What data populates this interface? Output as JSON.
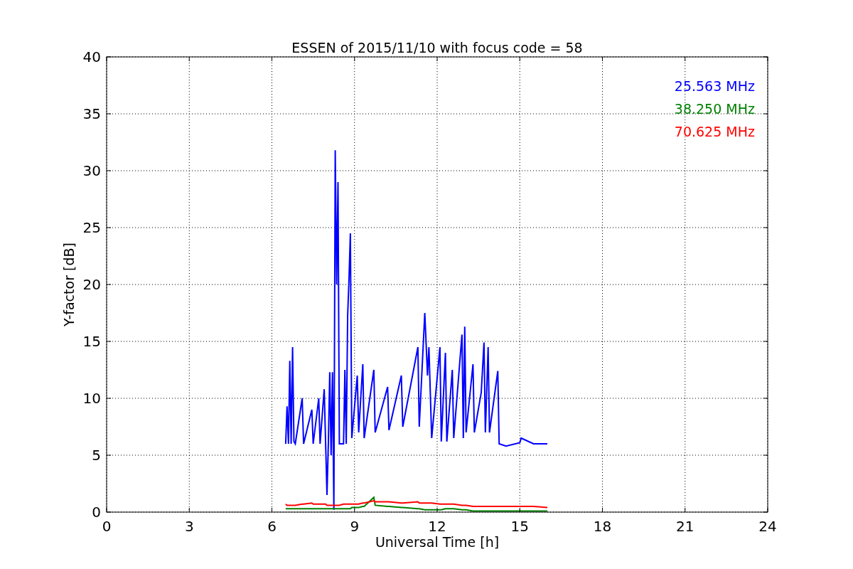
{
  "figure": {
    "chart_data": {
      "type": "line",
      "title": "ESSEN of 2015/11/10 with focus code = 58",
      "xlabel": "Universal Time [h]",
      "ylabel": "Y-factor [dB]",
      "xlim": [
        0,
        24
      ],
      "ylim": [
        0,
        40
      ],
      "xticks": [
        0,
        3,
        6,
        9,
        12,
        15,
        18,
        21,
        24
      ],
      "yticks": [
        0,
        5,
        10,
        15,
        20,
        25,
        30,
        35,
        40
      ],
      "grid": true,
      "x": [
        6.5,
        6.55,
        6.6,
        6.65,
        6.7,
        6.75,
        6.8,
        6.85,
        7.1,
        7.15,
        7.45,
        7.5,
        7.7,
        7.75,
        7.9,
        7.95,
        8.0,
        8.05,
        8.1,
        8.15,
        8.2,
        8.25,
        8.3,
        8.35,
        8.4,
        8.45,
        8.6,
        8.65,
        8.7,
        8.75,
        8.8,
        8.85,
        8.9,
        9.1,
        9.15,
        9.3,
        9.35,
        9.7,
        9.75,
        10.2,
        10.25,
        10.7,
        10.75,
        11.3,
        11.35,
        11.55,
        11.65,
        11.7,
        11.8,
        12.1,
        12.15,
        12.3,
        12.35,
        12.55,
        12.6,
        12.9,
        12.95,
        13.0,
        13.05,
        13.3,
        13.35,
        13.6,
        13.7,
        13.75,
        13.85,
        13.9,
        14.2,
        14.25,
        14.5,
        15.0,
        15.05,
        15.5,
        16.0
      ],
      "series": [
        {
          "name": "25.563 MHz",
          "color": "#0000ff",
          "values": [
            6,
            9.3,
            6,
            13.3,
            6,
            14.5,
            6.2,
            6,
            10,
            6,
            9,
            6,
            10,
            6,
            10.8,
            6,
            1.5,
            6,
            12.3,
            5,
            12.3,
            0.2,
            31.8,
            20,
            29,
            6,
            6,
            12.5,
            6,
            17.3,
            20.5,
            24.5,
            6.5,
            12,
            7,
            13,
            6.5,
            12.5,
            7,
            11,
            7.2,
            12,
            7.5,
            14.5,
            7.5,
            17.5,
            12,
            14.5,
            6.5,
            14.5,
            6.2,
            14,
            6.2,
            12.5,
            6.5,
            15.6,
            6.5,
            16.3,
            7,
            13,
            7,
            10.5,
            14.9,
            7,
            14.5,
            7,
            12.4,
            6,
            5.8,
            6.1,
            6.5,
            6,
            6
          ]
        },
        {
          "name": "38.250 MHz",
          "color": "#008000",
          "values": [
            0.3,
            0.3,
            0.3,
            0.3,
            0.3,
            0.3,
            0.3,
            0.3,
            0.3,
            0.3,
            0.3,
            0.3,
            0.3,
            0.3,
            0.3,
            0.3,
            0.3,
            0.3,
            0.3,
            0.3,
            0.3,
            0.3,
            0.3,
            0.3,
            0.3,
            0.3,
            0.3,
            0.3,
            0.3,
            0.3,
            0.3,
            0.3,
            0.4,
            0.4,
            0.4,
            0.5,
            0.5,
            1.3,
            0.6,
            0.5,
            0.5,
            0.4,
            0.4,
            0.3,
            0.3,
            0.2,
            0.2,
            0.2,
            0.2,
            0.2,
            0.2,
            0.3,
            0.3,
            0.3,
            0.3,
            0.2,
            0.2,
            0.2,
            0.2,
            0.1,
            0.1,
            0.1,
            0.1,
            0.1,
            0.1,
            0.1,
            0.1,
            0.1,
            0.1,
            0.1,
            0.1,
            0.1,
            0.1
          ]
        },
        {
          "name": "70.625 MHz",
          "color": "#ff0000",
          "values": [
            0.7,
            0.6,
            0.6,
            0.6,
            0.6,
            0.6,
            0.6,
            0.6,
            0.7,
            0.7,
            0.8,
            0.7,
            0.7,
            0.7,
            0.7,
            0.7,
            0.6,
            0.6,
            0.6,
            0.6,
            0.6,
            0.6,
            0.6,
            0.6,
            0.6,
            0.6,
            0.7,
            0.7,
            0.7,
            0.7,
            0.7,
            0.7,
            0.7,
            0.7,
            0.7,
            0.8,
            0.8,
            1.0,
            0.9,
            0.9,
            0.9,
            0.8,
            0.8,
            0.9,
            0.8,
            0.8,
            0.8,
            0.8,
            0.8,
            0.7,
            0.7,
            0.7,
            0.7,
            0.7,
            0.7,
            0.6,
            0.6,
            0.6,
            0.6,
            0.5,
            0.5,
            0.5,
            0.5,
            0.5,
            0.5,
            0.5,
            0.5,
            0.5,
            0.5,
            0.5,
            0.5,
            0.5,
            0.4
          ]
        }
      ]
    }
  }
}
